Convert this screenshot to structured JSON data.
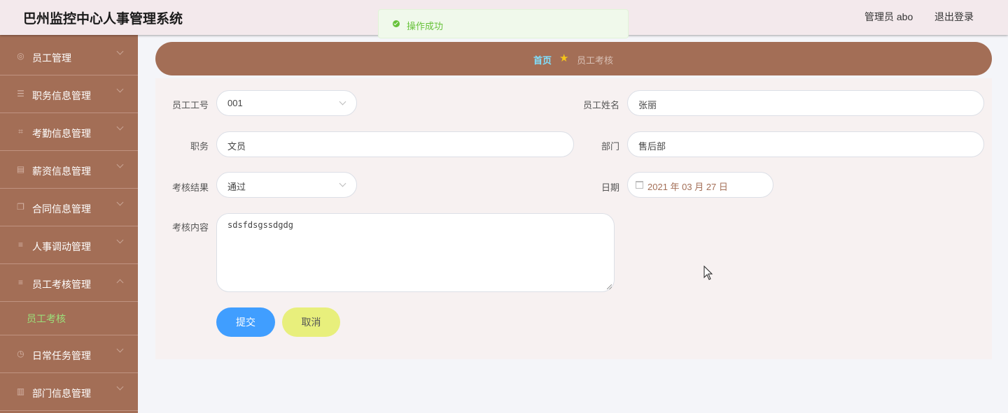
{
  "header": {
    "title": "巴州监控中心人事管理系统",
    "user": "管理员 abo",
    "logout": "退出登录"
  },
  "toast": {
    "message": "操作成功",
    "color": "#67c23a"
  },
  "sidebar": {
    "items": [
      {
        "label": "员工管理",
        "icon": "user-circle-icon"
      },
      {
        "label": "职务信息管理",
        "icon": "sliders-icon"
      },
      {
        "label": "考勤信息管理",
        "icon": "crop-icon"
      },
      {
        "label": "薪资信息管理",
        "icon": "money-icon"
      },
      {
        "label": "合同信息管理",
        "icon": "copy-icon"
      },
      {
        "label": "人事调动管理",
        "icon": "list-icon"
      },
      {
        "label": "员工考核管理",
        "icon": "list-icon",
        "expanded": true
      },
      {
        "label": "日常任务管理",
        "icon": "clock-icon"
      },
      {
        "label": "部门信息管理",
        "icon": "bank-icon"
      }
    ],
    "subitem": "员工考核"
  },
  "breadcrumb": {
    "home": "首页",
    "current": "员工考核"
  },
  "form": {
    "emp_no": {
      "label": "员工工号",
      "value": "001"
    },
    "emp_name": {
      "label": "员工姓名",
      "value": "张丽"
    },
    "position": {
      "label": "职务",
      "value": "文员"
    },
    "dept": {
      "label": "部门",
      "value": "售后部"
    },
    "result": {
      "label": "考核结果",
      "value": "通过"
    },
    "date": {
      "label": "日期",
      "value": "2021 年 03 月 27 日"
    },
    "content": {
      "label": "考核内容",
      "value": "sdsfdsgssdgdg"
    },
    "submit": "提交",
    "cancel": "取消"
  },
  "colors": {
    "sidebar": "#a36e56",
    "primary": "#409eff",
    "cancel": "#e8ef7c"
  }
}
